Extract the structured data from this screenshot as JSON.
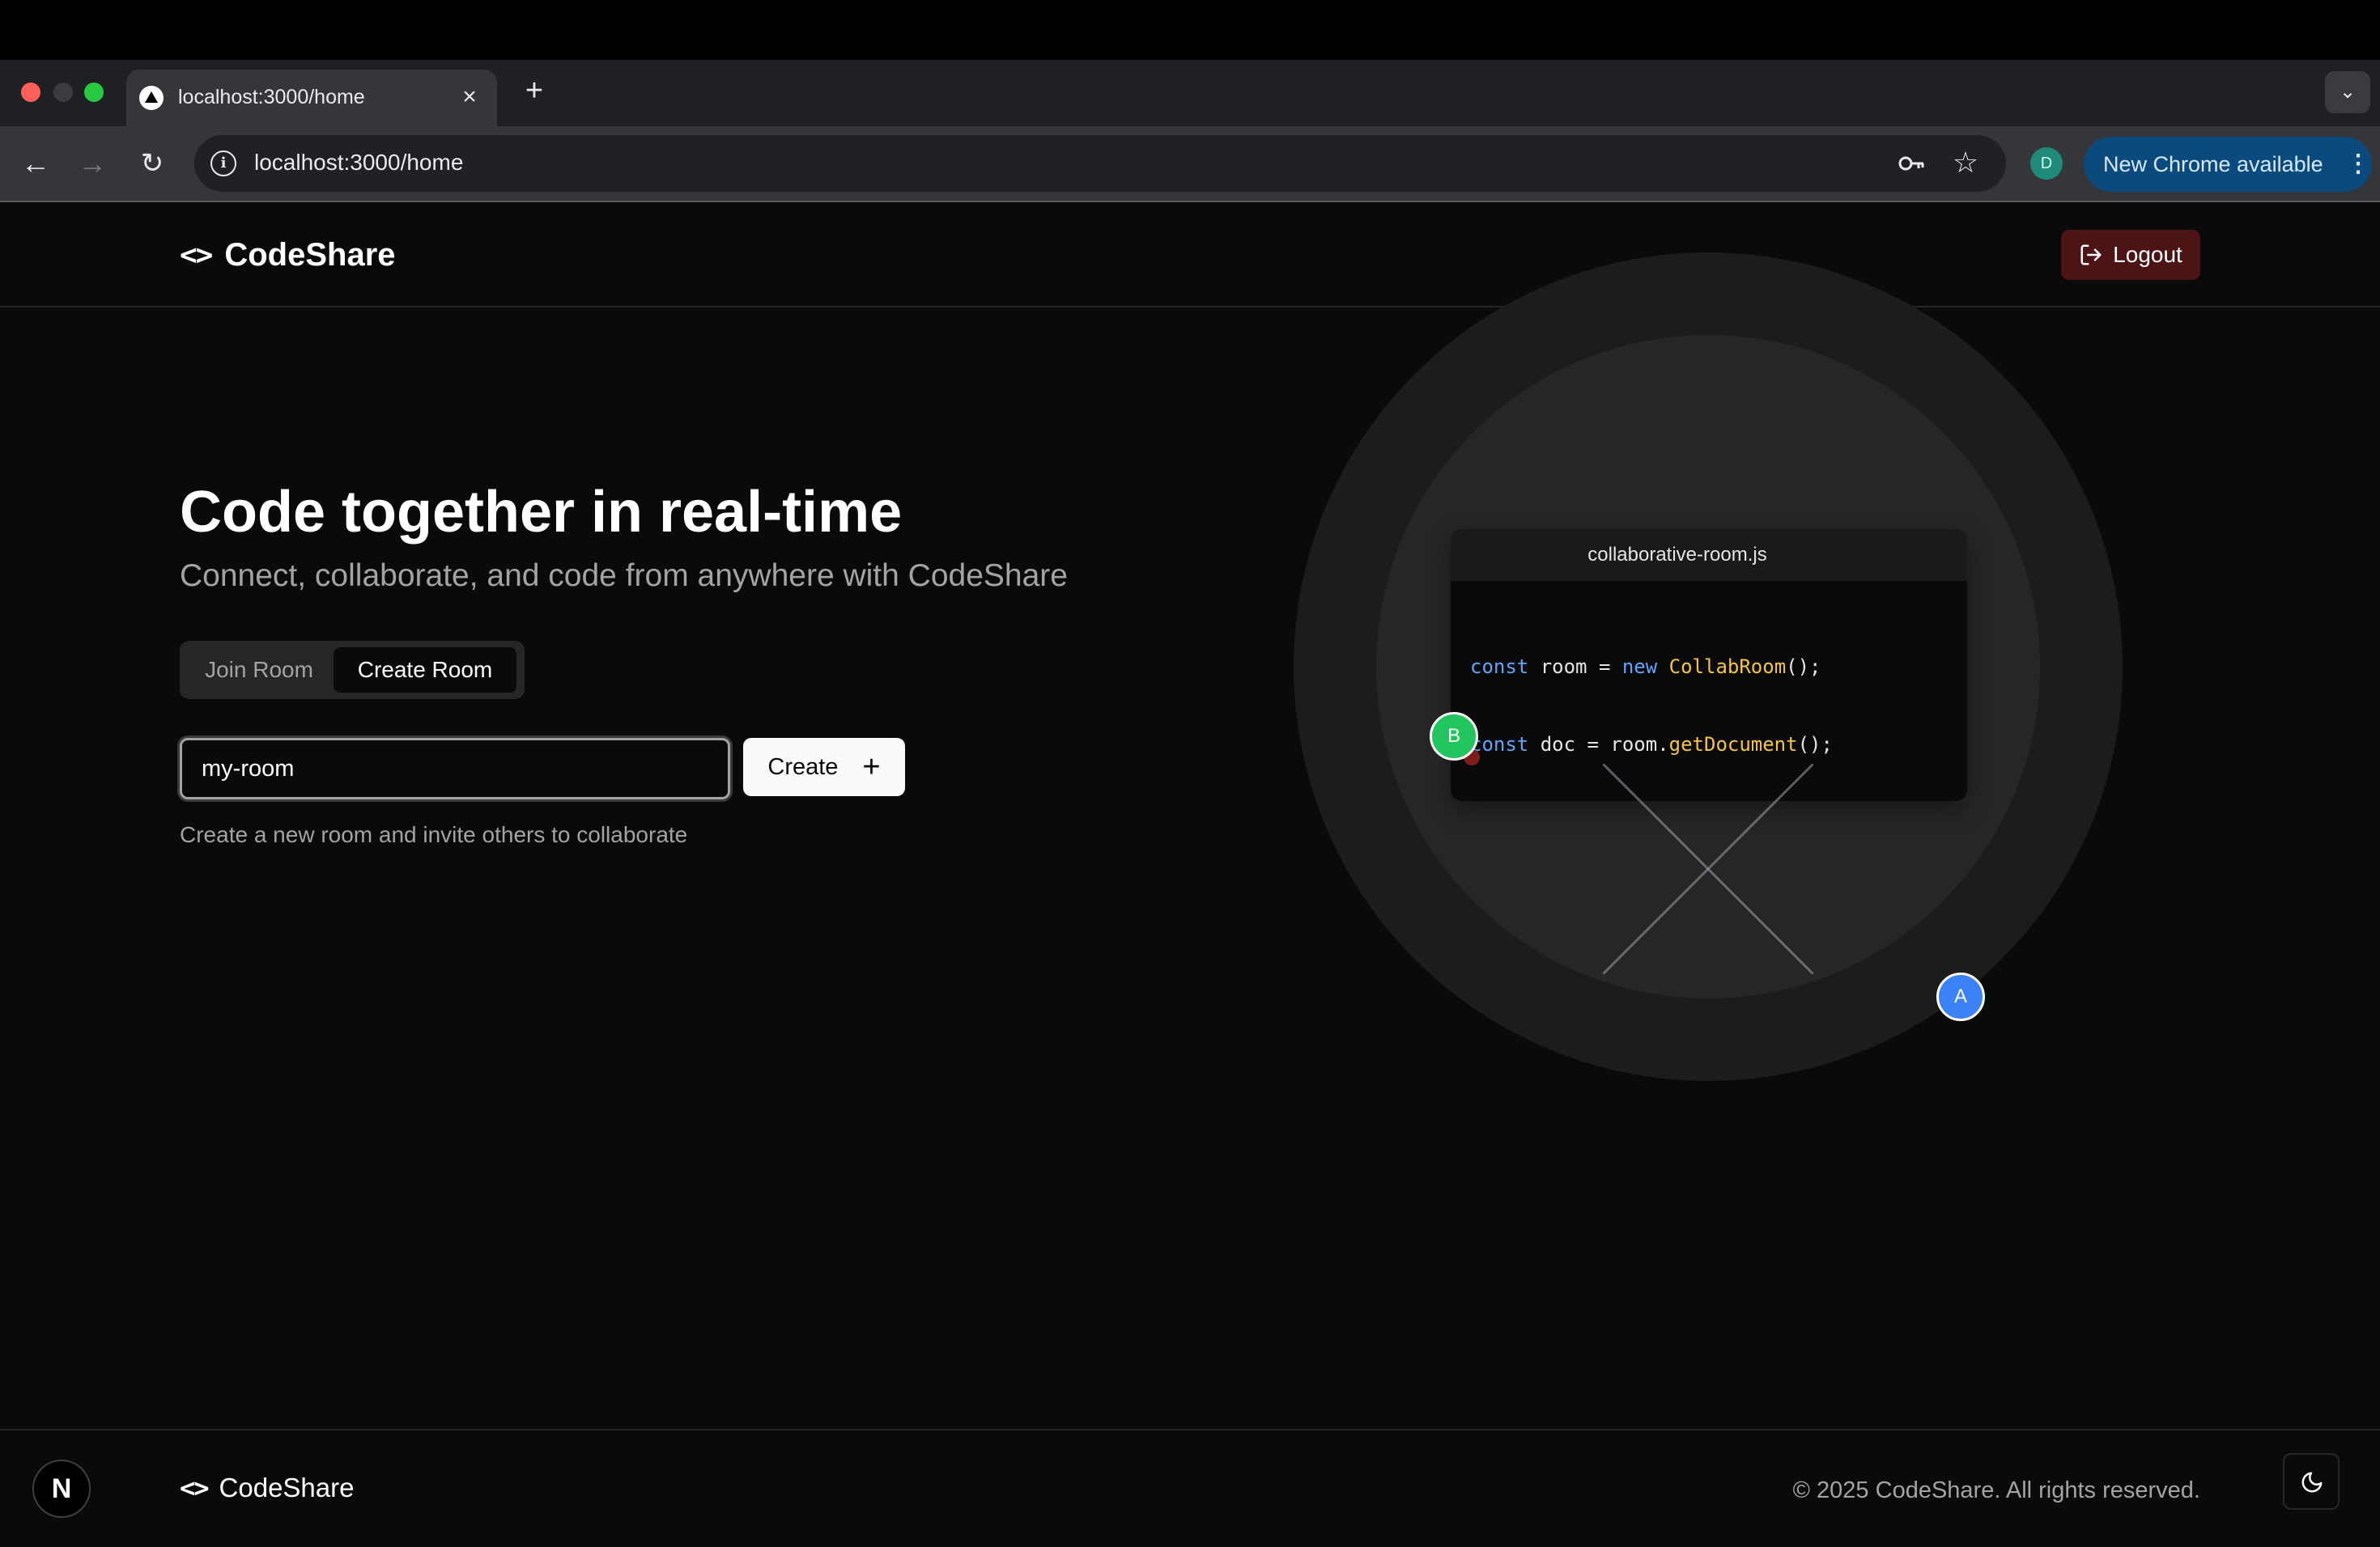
{
  "browser": {
    "tab_title": "localhost:3000/home",
    "tab_close_glyph": "×",
    "new_tab_glyph": "+",
    "tab_search_glyph": "⌄",
    "url": "localhost:3000/home",
    "profile_initial": "D",
    "update_label": "New Chrome available",
    "update_menu_glyph": "⋮",
    "back_glyph": "←",
    "forward_glyph": "→",
    "reload_glyph": "↻",
    "star_glyph": "☆",
    "info_glyph": "i"
  },
  "header": {
    "logo_icon": "<>",
    "brand": "CodeShare",
    "logout_label": "Logout"
  },
  "hero": {
    "title": "Code together in real-time",
    "subtitle": "Connect, collaborate, and code from anywhere with CodeShare",
    "tabs": [
      {
        "label": "Join Room",
        "active": false
      },
      {
        "label": "Create Room",
        "active": true
      }
    ],
    "room_input_value": "my-room",
    "create_label": "Create",
    "create_icon": "+",
    "hint": "Create a new room and invite others to collaborate"
  },
  "illustration": {
    "filename": "collaborative-room.js",
    "avatar_b": "B",
    "avatar_a": "A"
  },
  "footer": {
    "logo_icon": "<>",
    "brand": "CodeShare",
    "copyright": "© 2025 CodeShare. All rights reserved.",
    "next_badge": "N"
  },
  "colors": {
    "background": "#0a0a0a",
    "logout_bg": "#4d1416",
    "keyword": "#60a5fa",
    "function": "#f5c542",
    "string": "#4ade80",
    "avatar_b": "#22c55e",
    "avatar_a": "#3b82f6",
    "chrome_update": "#0b4a7d"
  },
  "icons": [
    "back-arrow-icon",
    "forward-arrow-icon",
    "reload-icon",
    "info-icon",
    "key-icon",
    "star-icon",
    "code-brackets-icon",
    "logout-icon",
    "plus-icon",
    "moon-icon",
    "nextjs-icon"
  ]
}
